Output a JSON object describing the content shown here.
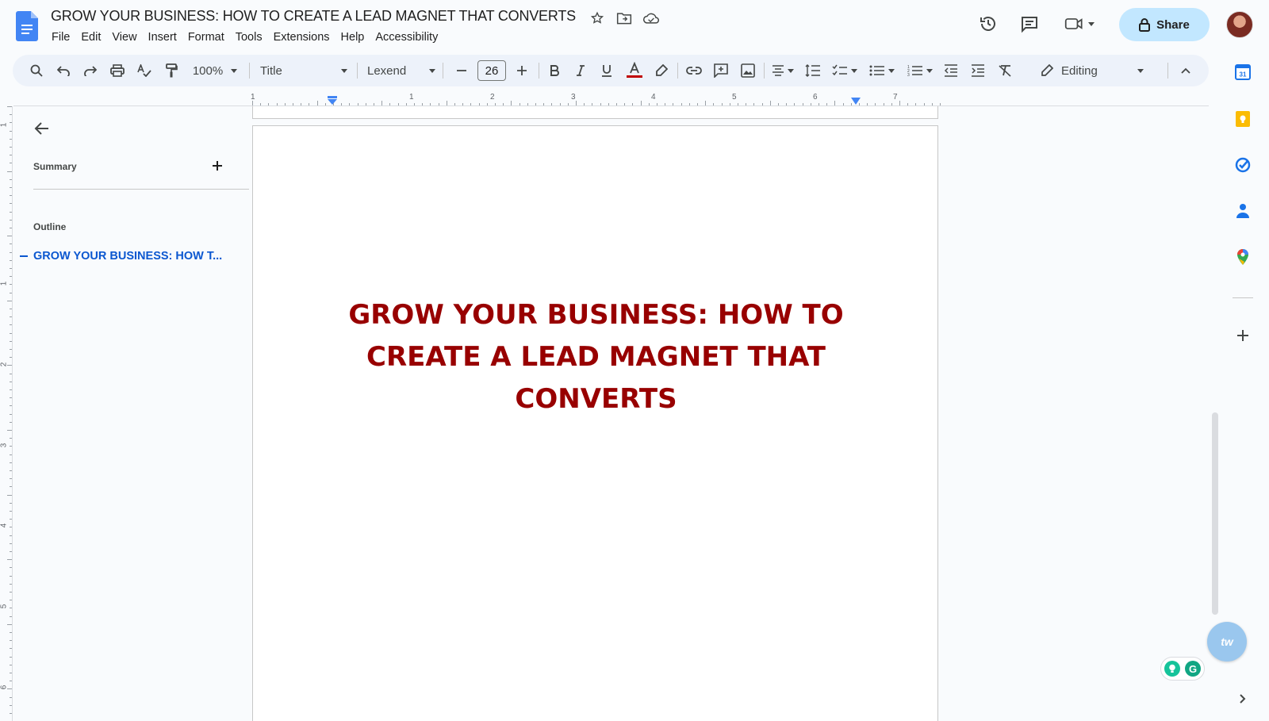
{
  "header": {
    "doc_title": "GROW YOUR BUSINESS: HOW TO CREATE A LEAD MAGNET THAT CONVERTS",
    "menu": [
      "File",
      "Edit",
      "View",
      "Insert",
      "Format",
      "Tools",
      "Extensions",
      "Help",
      "Accessibility"
    ],
    "share_label": "Share"
  },
  "toolbar": {
    "zoom": "100%",
    "style": "Title",
    "font": "Lexend",
    "font_size": "26",
    "mode": "Editing",
    "text_color": "#c00000"
  },
  "panel": {
    "summary_label": "Summary",
    "outline_label": "Outline",
    "outline_items": [
      "GROW YOUR BUSINESS: HOW T..."
    ]
  },
  "ruler": {
    "h_numbers": [
      "1",
      "1",
      "2",
      "3",
      "4",
      "5",
      "6",
      "7"
    ],
    "v_numbers": [
      "1",
      "1",
      "2",
      "3",
      "4",
      "5",
      "6"
    ]
  },
  "document": {
    "heading": "GROW YOUR BUSINESS: HOW TO CREATE A LEAD MAGNET THAT CONVERTS",
    "heading_color": "#980000"
  },
  "side_panel": {
    "calendar_day": "31"
  },
  "assistant": {
    "bubble_text": "tw",
    "grammarly_letter": "G"
  }
}
